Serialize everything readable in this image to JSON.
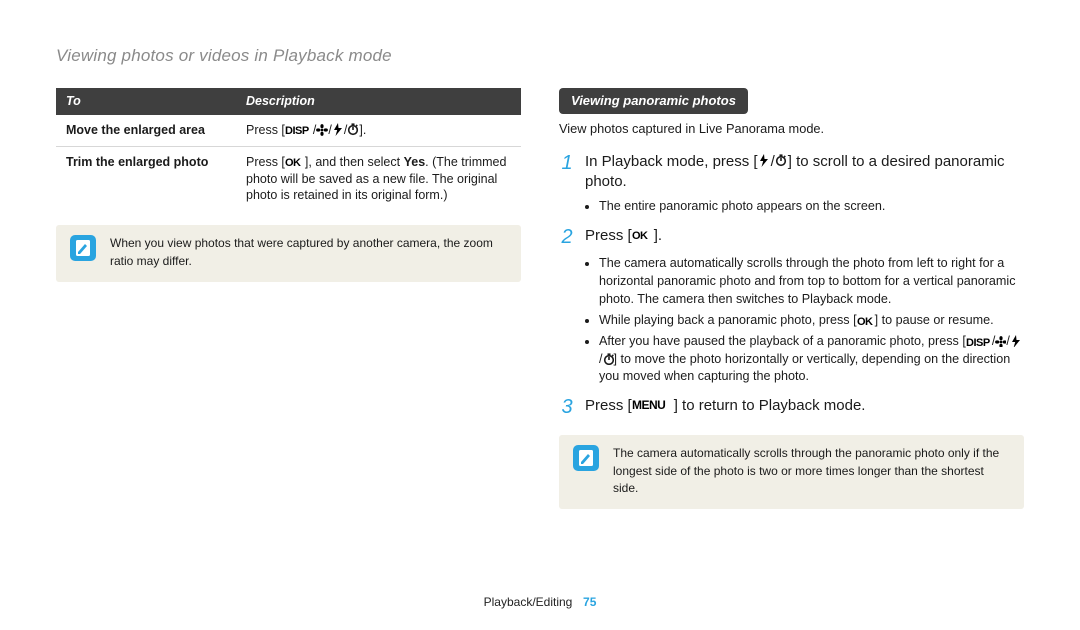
{
  "page_title": "Viewing photos or videos in Playback mode",
  "table": {
    "head_to": "To",
    "head_desc": "Description",
    "row1_label": "Move the enlarged area",
    "row1_prefix": "Press [",
    "row1_suffix": "].",
    "row2_label": "Trim the enlarged photo",
    "row2_a": "Press [",
    "row2_b": "], and then select ",
    "row2_yes": "Yes",
    "row2_c": ". (The trimmed photo will be saved as a new file. The original photo is retained in its original form.)"
  },
  "note_left": "When you view photos that were captured by another camera, the zoom ratio may differ.",
  "right": {
    "pill": "Viewing panoramic photos",
    "intro": "View photos captured in Live Panorama mode.",
    "step1_a": "In Playback mode, press [",
    "step1_b": "] to scroll to a desired panoramic photo.",
    "step1_sub1": "The entire panoramic photo appears on the screen.",
    "step2_a": "Press [",
    "step2_b": "].",
    "step2_sub1": "The camera automatically scrolls through the photo from left to right for a horizontal panoramic photo and from top to bottom for a vertical panoramic photo. The camera then switches to Playback mode.",
    "step2_sub2_a": "While playing back a panoramic photo, press [",
    "step2_sub2_b": "] to pause or resume.",
    "step2_sub3_a": "After you have paused the playback of a panoramic photo, press [",
    "step2_sub3_b": "] to move the photo horizontally or vertically, depending on the direction you moved when capturing the photo.",
    "step3_a": "Press [",
    "step3_b": "] to return to Playback mode.",
    "note_right": "The camera automatically scrolls through the panoramic photo only if the longest side of the photo is two or more times longer than the shortest side."
  },
  "footer_section": "Playback/Editing",
  "footer_page": "75",
  "icons": {
    "disp": "DISP",
    "macro": "macro-icon",
    "flash": "flash-icon",
    "timer": "timer-icon",
    "ok": "OK",
    "menu": "MENU"
  }
}
